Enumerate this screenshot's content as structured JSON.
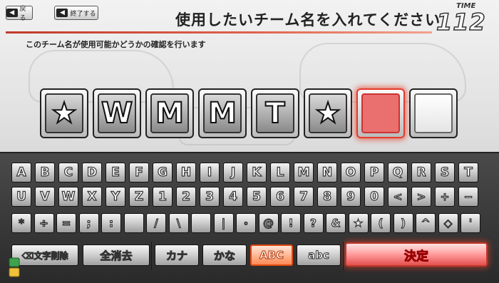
{
  "header": {
    "back_label": "戻る",
    "quit_label": "終了する",
    "title": "使用したいチーム名を入れてください",
    "subtitle": "このチーム名が使用可能かどうかの確認を行います"
  },
  "timer": {
    "label": "TIME",
    "value": "112"
  },
  "name_slots": [
    {
      "char": "★",
      "state": "filled"
    },
    {
      "char": "W",
      "state": "filled"
    },
    {
      "char": "M",
      "state": "filled"
    },
    {
      "char": "M",
      "state": "filled"
    },
    {
      "char": "T",
      "state": "filled"
    },
    {
      "char": "★",
      "state": "filled"
    },
    {
      "char": "",
      "state": "cursor"
    },
    {
      "char": "",
      "state": "empty"
    }
  ],
  "keyboard": {
    "row1": [
      "A",
      "B",
      "C",
      "D",
      "E",
      "F",
      "G",
      "H",
      "I",
      "J",
      "K",
      "L",
      "M",
      "N",
      "O",
      "P",
      "Q",
      "R",
      "S",
      "T"
    ],
    "row2": [
      "U",
      "V",
      "W",
      "X",
      "Y",
      "Z",
      "1",
      "2",
      "3",
      "4",
      "5",
      "6",
      "7",
      "8",
      "9",
      "0",
      "<",
      ">",
      "+",
      "−"
    ],
    "row3": [
      "*",
      "÷",
      "=",
      ";",
      ":",
      "",
      "/",
      "\\",
      "",
      "|",
      "・",
      "@",
      "!",
      "?",
      "&",
      "★",
      "(",
      ")",
      "^",
      "◇",
      "'"
    ],
    "backspace_label": "⌫文字削除",
    "clear_all_label": "全消去",
    "katakana_label": "カナ",
    "hiragana_label": "かな",
    "upper_label": "ABC",
    "lower_label": "abc",
    "selected_mode": "ABC",
    "confirm_label": "決定"
  },
  "colors": {
    "accent": "#e53a2b",
    "selected": "#ff8a55"
  }
}
